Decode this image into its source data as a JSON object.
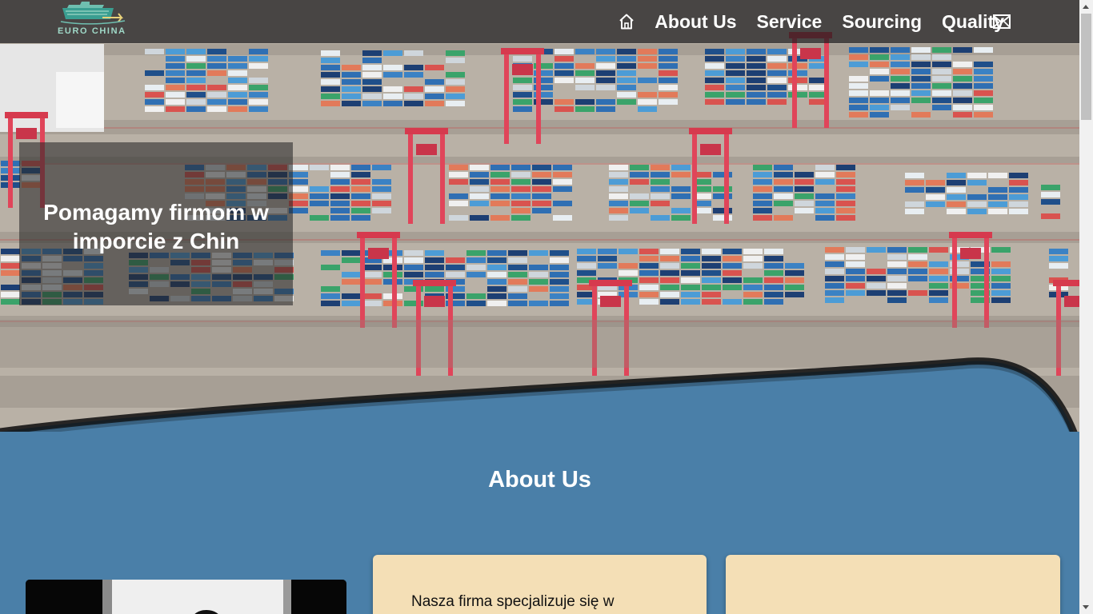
{
  "header": {
    "logo_text": "EURO CHINA",
    "nav": [
      {
        "label": "About Us"
      },
      {
        "label": "Service"
      },
      {
        "label": "Sourcing"
      },
      {
        "label": "Quality"
      }
    ],
    "home_icon": "home-icon",
    "mail_icon": "mail-icon"
  },
  "hero": {
    "heading": "Pomagamy firmom w imporcie z Chin"
  },
  "about": {
    "title": "About Us",
    "card1_text": "Nasza firma specjalizuje się w"
  },
  "colors": {
    "section_bg": "#4a7fa8",
    "card_bg": "#f4dfb6",
    "logo_accent": "#9fd8c7"
  }
}
